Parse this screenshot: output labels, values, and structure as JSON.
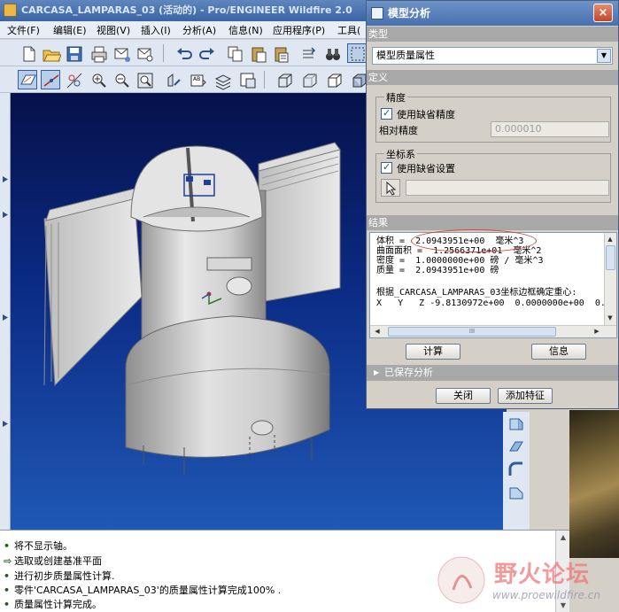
{
  "window": {
    "title": "CARCASA_LAMPARAS_03 (活动的) - Pro/ENGINEER Wildfire 2.0"
  },
  "menu": [
    {
      "label": "文件(F)",
      "name": "menu-file"
    },
    {
      "label": "编辑(E)",
      "name": "menu-edit"
    },
    {
      "label": "视图(V)",
      "name": "menu-view"
    },
    {
      "label": "插入(I)",
      "name": "menu-insert"
    },
    {
      "label": "分析(A)",
      "name": "menu-analysis"
    },
    {
      "label": "信息(N)",
      "name": "menu-info"
    },
    {
      "label": "应用程序(P)",
      "name": "menu-applications"
    },
    {
      "label": "工具(",
      "name": "menu-tools"
    }
  ],
  "toolbar_icons": {
    "row1": [
      "new-file-icon",
      "open-folder-icon",
      "save-icon",
      "print-icon",
      "send-mail-icon",
      "mail-icon",
      "undo-icon",
      "redo-icon",
      "copy-icon",
      "paste-icon",
      "paste-special-icon",
      "binoculars-icon",
      "select-box-icon"
    ],
    "row2": [
      "datum-plane-display-icon",
      "datum-axis-display-icon",
      "datum-point-display-icon",
      "zoom-in-icon",
      "zoom-out-icon",
      "refit-icon",
      "reorient-icon",
      "saved-views-icon",
      "layers-icon",
      "model-display-icon",
      "wireframe-icon",
      "hidden-line-icon",
      "no-hidden-icon",
      "shading-icon"
    ]
  },
  "dialog": {
    "title": "模型分析",
    "close_glyph": "×",
    "type_section": "类型",
    "type_value": "模型质量属性",
    "definition_section": "定义",
    "precision_group": "精度",
    "use_default_precision": "使用缺省精度",
    "relative_precision_label": "相对精度",
    "relative_precision_value": "0.000010",
    "coord_group": "坐标系",
    "use_default_setting": "使用缺省设置",
    "results_section": "结果",
    "results_lines": [
      "体积 =  2.0943951e+00  毫米^3",
      "曲面面积 =  1.2566371e+01  毫米^2",
      "密度 =  1.0000000e+00 磅 / 毫米^3",
      "质量 =  2.0943951e+00 磅",
      "",
      "根据_CARCASA_LAMPARAS_03坐标边框确定重心:",
      "X   Y   Z -9.8130972e+00  0.0000000e+00  0."
    ],
    "compute_button": "计算",
    "info_button": "信息",
    "saved_analysis": "已保存分析",
    "close_button": "关闭",
    "add_feature_button": "添加特征"
  },
  "hscroll_glyph": "III",
  "messages": [
    {
      "text": "将不显示轴。",
      "bullet": "•"
    },
    {
      "text": "选取或创建基准平面",
      "bullet": "⇨"
    },
    {
      "text": "进行初步质量属性计算.",
      "bullet": "•"
    },
    {
      "text": "零件'CARCASA_LAMPARAS_03'的质量属性计算完成100% .",
      "bullet": "•"
    },
    {
      "text": "质量属性计算完成。",
      "bullet": "•"
    }
  ],
  "watermark": {
    "title": "野火论坛",
    "url": "www.proewildfire.cn"
  },
  "colors": {
    "viewport_top": "#06114a",
    "viewport_bottom": "#1f58b5",
    "highlight": "#d8413a",
    "dialog_title": "#4770ae"
  }
}
